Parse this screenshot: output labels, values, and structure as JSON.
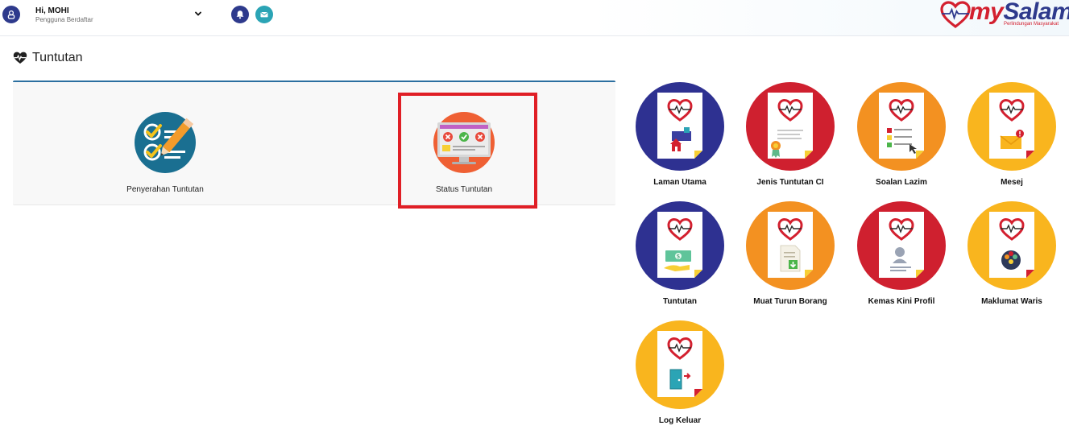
{
  "header": {
    "greeting": "Hi, MOHI",
    "role": "Pengguna Berdaftar",
    "brand": {
      "my": "my",
      "name": "Salam",
      "tagline": "Perlindungan Masyarakat"
    }
  },
  "page": {
    "title": "Tuntutan"
  },
  "claims_panel": {
    "options": [
      {
        "label": "Penyerahan Tuntutan"
      },
      {
        "label": "Status Tuntutan"
      }
    ]
  },
  "menu": {
    "tiles": [
      {
        "label": "Laman Utama",
        "color": "#2e3191",
        "icon": "home-icon"
      },
      {
        "label": "Jenis Tuntutan CI",
        "color": "#cf202f",
        "icon": "certificate-icon"
      },
      {
        "label": "Soalan Lazim",
        "color": "#f39121",
        "icon": "faq-icon"
      },
      {
        "label": "Mesej",
        "color": "#f9b51e",
        "icon": "envelope-icon"
      },
      {
        "label": "Tuntutan",
        "color": "#2e3191",
        "icon": "money-icon"
      },
      {
        "label": "Muat Turun Borang",
        "color": "#f39121",
        "icon": "download-form-icon"
      },
      {
        "label": "Kemas Kini Profil",
        "color": "#cf202f",
        "icon": "profile-icon"
      },
      {
        "label": "Maklumat Waris",
        "color": "#f9b51e",
        "icon": "family-icon"
      },
      {
        "label": "Log Keluar",
        "color": "#f9b51e",
        "icon": "logout-door-icon"
      }
    ]
  },
  "colors": {
    "navy": "#2e3a8c",
    "teal": "#2ba4b5",
    "red": "#d3202f",
    "panel_border": "#2c6fa0",
    "highlight": "#e01f26"
  }
}
